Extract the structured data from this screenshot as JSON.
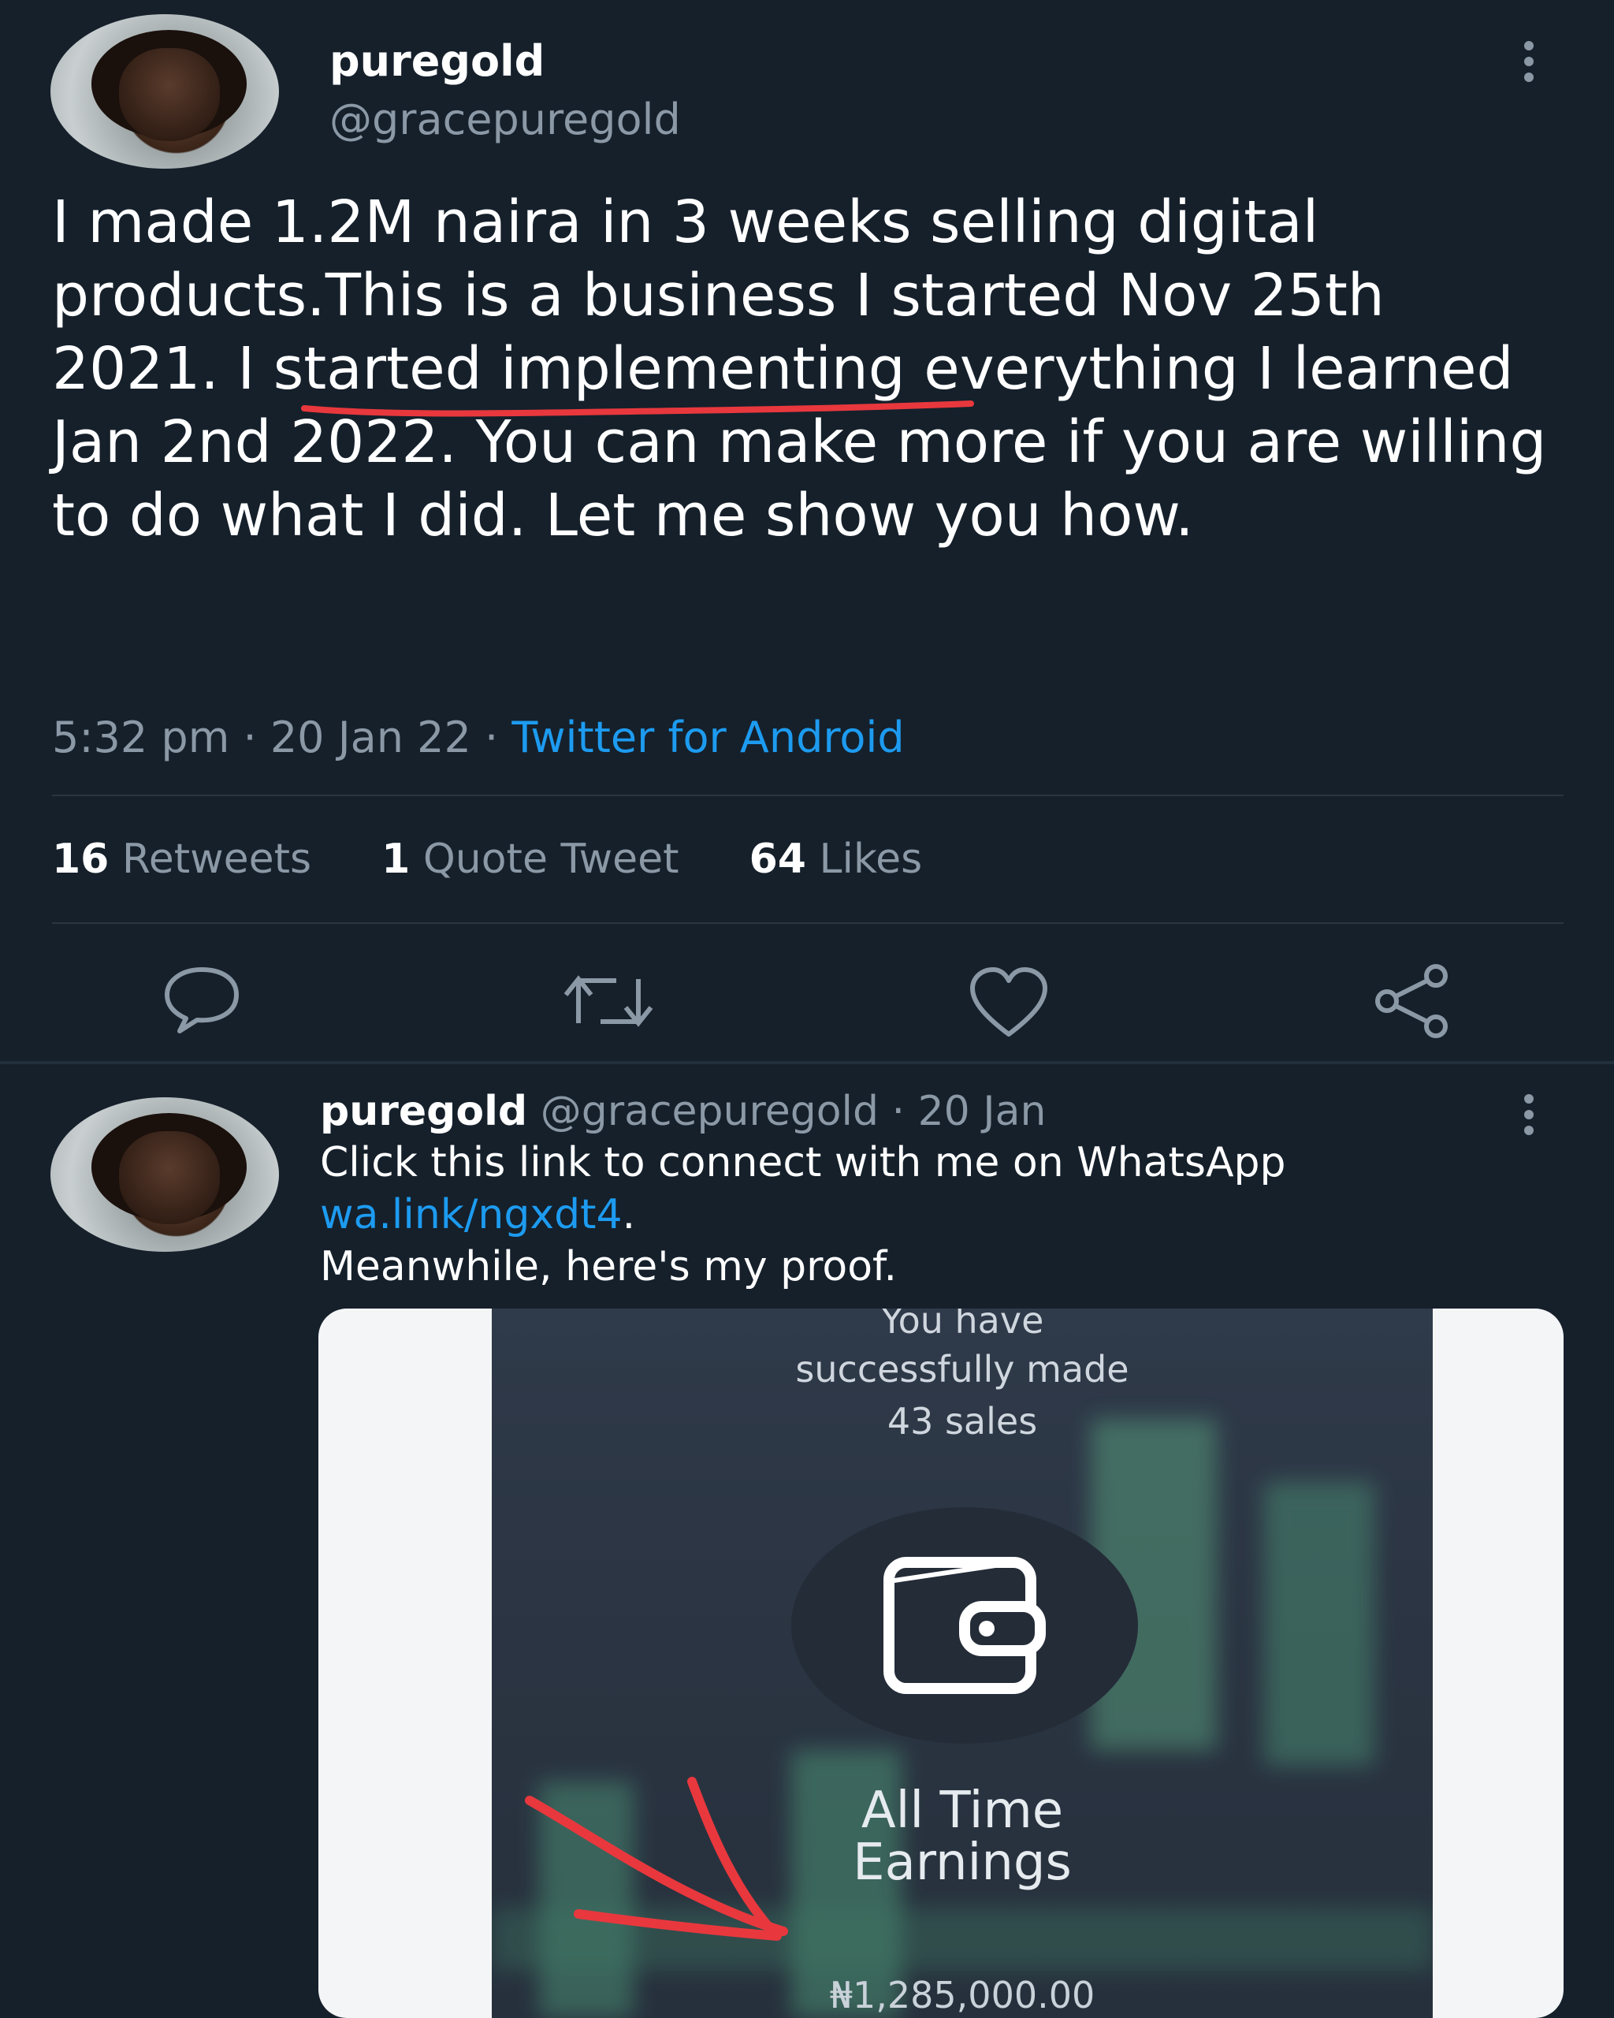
{
  "main_tweet": {
    "display_name": "puregold",
    "handle": "@gracepuregold",
    "text_before_underline": "I made 1.2M naira in 3 weeks selling digital products.This is a business I started ",
    "text_underlined": "Nov 25th 2021. I",
    "text_after_underline": " started implementing everything I learned Jan 2nd 2022. You can make more if you are willing to do what I did. Let me show you how.",
    "time": "5:32 pm",
    "date": "20 Jan 22",
    "client": "Twitter for Android",
    "stats": {
      "retweets_count": "16",
      "retweets_label": "Retweets",
      "quotes_count": "1",
      "quotes_label": "Quote Tweet",
      "likes_count": "64",
      "likes_label": "Likes"
    }
  },
  "reply_tweet": {
    "display_name": "puregold",
    "handle": "@gracepuregold",
    "date": "20 Jan",
    "line1": "Click this link to connect with me on WhatsApp",
    "link": "wa.link/ngxdt4",
    "link_suffix": ".",
    "line3": "Meanwhile, here's my proof.",
    "proof_image": {
      "line1": "You have",
      "line2": "successfully made",
      "line3": "43 sales",
      "earnings_label_1": "All Time",
      "earnings_label_2": "Earnings",
      "amount": "₦1,285,000.00"
    }
  },
  "icons": {
    "reply": "reply-icon",
    "retweet": "retweet-icon",
    "like": "heart-icon",
    "share": "share-icon",
    "more": "more-options-icon",
    "wallet": "wallet-icon"
  },
  "colors": {
    "background": "#15202b",
    "text": "#ffffff",
    "muted": "#8b98a5",
    "link": "#1d9bf0",
    "annotation_red": "#e8383d"
  }
}
